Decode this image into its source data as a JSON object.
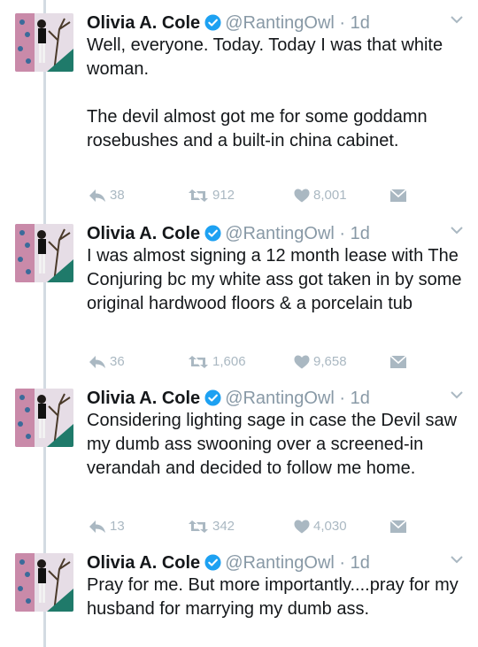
{
  "tweets": [
    {
      "name": "Olivia A. Cole",
      "handle": "@RantingOwl",
      "dot": "·",
      "time": "1d",
      "paragraphs": [
        "Well, everyone. Today. Today I was that white woman.",
        "The devil almost got me for some goddamn rosebushes and a built-in china cabinet."
      ],
      "replies": "38",
      "retweets": "912",
      "likes": "8,001"
    },
    {
      "name": "Olivia A. Cole",
      "handle": "@RantingOwl",
      "dot": "·",
      "time": "1d",
      "paragraphs": [
        "I was almost signing a 12 month lease with The Conjuring bc my white ass got taken in by some original hardwood floors & a porcelain tub"
      ],
      "replies": "36",
      "retweets": "1,606",
      "likes": "9,658"
    },
    {
      "name": "Olivia A. Cole",
      "handle": "@RantingOwl",
      "dot": "·",
      "time": "1d",
      "paragraphs": [
        "Considering lighting sage in case the Devil saw my dumb ass swooning over a screened-in verandah and decided to follow me home."
      ],
      "replies": "13",
      "retweets": "342",
      "likes": "4,030"
    },
    {
      "name": "Olivia A. Cole",
      "handle": "@RantingOwl",
      "dot": "·",
      "time": "1d",
      "paragraphs": [
        "Pray for me. But more importantly....pray for my husband for marrying my dumb ass."
      ]
    }
  ],
  "colors": {
    "verified": "#1da1f2",
    "meta": "#8899a6",
    "action": "#aab8c2",
    "thread_line": "#d3dbe2"
  },
  "icons": [
    "verified-badge-icon",
    "chevron-down-icon",
    "reply-icon",
    "retweet-icon",
    "like-icon",
    "direct-message-icon"
  ]
}
